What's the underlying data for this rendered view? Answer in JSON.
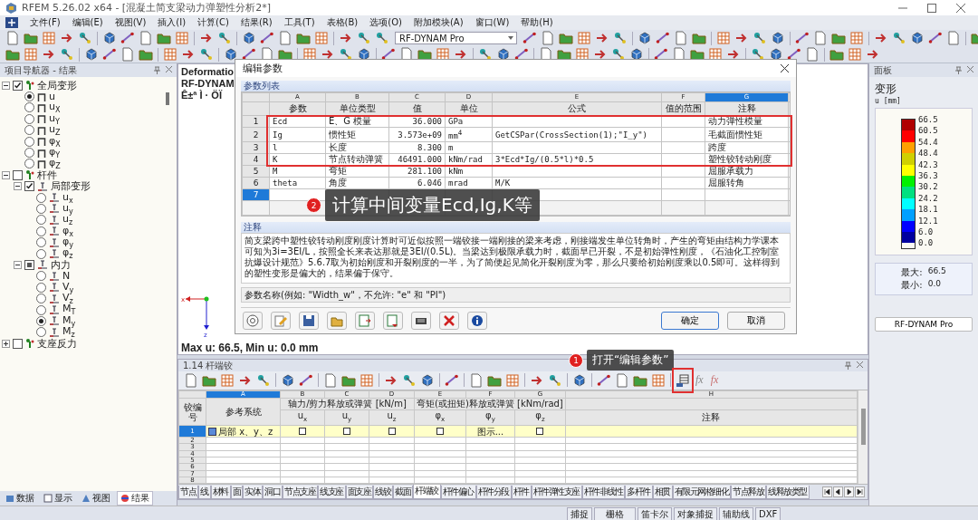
{
  "window": {
    "title": "RFEM 5.26.02 x64 - [混凝土简支梁动力弹塑性分析2*]"
  },
  "menu": [
    "文件(F)",
    "编辑(E)",
    "视图(V)",
    "插入(I)",
    "计算(C)",
    "结果(R)",
    "工具(T)",
    "表格(B)",
    "选项(O)",
    "附加模块(A)",
    "窗口(W)",
    "帮助(H)"
  ],
  "toolbar": {
    "combo": "RF-DYNAM Pro"
  },
  "navigator": {
    "title": "项目导航器 - 结果",
    "tree": [
      {
        "label": "全局变形",
        "kind": "check",
        "checked": true,
        "partial": false,
        "expanded": true,
        "children": [
          {
            "label": "u",
            "kind": "radio",
            "selected": true
          },
          {
            "label": "u$_{X}$",
            "kind": "radio",
            "selected": false
          },
          {
            "label": "u$_{Y}$",
            "kind": "radio",
            "selected": false
          },
          {
            "label": "u$_{Z}$",
            "kind": "radio",
            "selected": false
          },
          {
            "label": "φ$_{X}$",
            "kind": "radio",
            "selected": false
          },
          {
            "label": "φ$_{Y}$",
            "kind": "radio",
            "selected": false
          },
          {
            "label": "φ$_{Z}$",
            "kind": "radio",
            "selected": false
          }
        ]
      },
      {
        "label": "杆件",
        "kind": "check",
        "checked": false,
        "partial": false,
        "expanded": true,
        "children": [
          {
            "label": "局部变形",
            "kind": "check",
            "checked": true,
            "partial": false,
            "expanded": true,
            "children": [
              {
                "label": "u$_{x}$",
                "kind": "radio",
                "selected": false
              },
              {
                "label": "u$_{y}$",
                "kind": "radio",
                "selected": false
              },
              {
                "label": "u$_{z}$",
                "kind": "radio",
                "selected": false
              },
              {
                "label": "φ$_{x}$",
                "kind": "radio",
                "selected": false
              },
              {
                "label": "φ$_{y}$",
                "kind": "radio",
                "selected": false
              },
              {
                "label": "φ$_{z}$",
                "kind": "radio",
                "selected": false
              }
            ]
          },
          {
            "label": "内力",
            "kind": "check",
            "checked": false,
            "partial": true,
            "expanded": true,
            "children": [
              {
                "label": "N",
                "kind": "radio",
                "selected": false
              },
              {
                "label": "V$_{y}$",
                "kind": "radio",
                "selected": false
              },
              {
                "label": "V$_{z}$",
                "kind": "radio",
                "selected": false
              },
              {
                "label": "M$_{T}$",
                "kind": "radio",
                "selected": false
              },
              {
                "label": "M$_{y}$",
                "kind": "radio",
                "selected": true
              },
              {
                "label": "M$_{z}$",
                "kind": "radio",
                "selected": false
              }
            ]
          }
        ]
      },
      {
        "label": "支座反力",
        "kind": "check",
        "checked": false,
        "partial": false,
        "expanded": false
      }
    ],
    "tabs": [
      {
        "label": "数据",
        "selected": false
      },
      {
        "label": "显示",
        "selected": false
      },
      {
        "label": "视图",
        "selected": false
      },
      {
        "label": "结果",
        "selected": true
      }
    ]
  },
  "viewport": {
    "lines": [
      "Deformatio",
      "RF-DYNAM",
      "Ê±ª Ì · ÖÏ"
    ],
    "axes": [
      "x",
      "z"
    ],
    "footer": "Max u: 66.5, Min u: 0.0 mm"
  },
  "dialog": {
    "title": "编辑参数",
    "section": "参数列表",
    "table": {
      "columns": [
        {
          "letter": "A",
          "title": "参数",
          "selected": false
        },
        {
          "letter": "B",
          "title": "单位类型",
          "selected": false
        },
        {
          "letter": "C",
          "title": "值",
          "selected": false
        },
        {
          "letter": "D",
          "title": "单位",
          "selected": false
        },
        {
          "letter": "E",
          "title": "公式",
          "selected": false
        },
        {
          "letter": "F",
          "title": "值的范围",
          "selected": false
        },
        {
          "letter": "G",
          "title": "注释",
          "selected": true
        }
      ],
      "rows": [
        {
          "number": "1",
          "selected": false,
          "cells": [
            "Ecd",
            "E、G 模量",
            "36.000",
            "GPa",
            null,
            null,
            "动力弹性模量"
          ]
        },
        {
          "number": "2",
          "selected": false,
          "cells": [
            "Ig",
            "惯性矩",
            "3.573e+09",
            "mm$^{4}$",
            "GetCSPar(CrossSection(1);\"I_y\")",
            null,
            "毛截面惯性矩"
          ]
        },
        {
          "number": "3",
          "selected": false,
          "cells": [
            "l",
            "长度",
            "8.300",
            "m",
            null,
            null,
            "跨度"
          ]
        },
        {
          "number": "4",
          "selected": false,
          "cells": [
            "K",
            "节点转动弹簧",
            "46491.000",
            "kNm/rad",
            "3*Ecd*Ig/(0.5*l)*0.5",
            null,
            "塑性铰转动刚度"
          ]
        },
        {
          "number": "5",
          "selected": false,
          "cells": [
            "M",
            "弯矩",
            "281.100",
            "kNm",
            null,
            null,
            "屈服承载力"
          ]
        },
        {
          "number": "6",
          "selected": false,
          "cells": [
            "theta",
            "角度",
            "6.046",
            "mrad",
            "M/K",
            null,
            "屈服转角"
          ]
        },
        {
          "number": "7",
          "selected": true
        }
      ]
    },
    "note_title": "注释",
    "note": "简支梁跨中塑性铰转动刚度刚度计算时可近似按照一端铰接一端刚接的梁来考虑，刚接端发生单位转角时，产生的弯矩由结构力学课本可知为3i=3EI/L，按照全长来表达那就是3EI/(0.5L)。当梁达到极限承载力时，截面早已开裂，不是初始弹性刚度，《石油化工控制室抗爆设计规范》5.6.7取为初始刚度和开裂刚度的一半，为了简便起见简化开裂刚度为零，那么只要给初始刚度乘以0.5即可。这样得到的塑性变形是偏大的，结果偏于保守。",
    "hint": "参数名称(例如: \"Width_w\"，不允许: \"e\" 和 \"PI\")",
    "buttons": [
      "确定",
      "取消"
    ]
  },
  "table_panel": {
    "title": "1.14 杆端铰",
    "formula_buttons": [
      "fx",
      "fx"
    ],
    "row_header": "铰编号",
    "columns": [
      {
        "letter": "A",
        "title": "参考系统",
        "selected": true
      },
      {
        "letter": "B",
        "sub": "u$_{x}$",
        "selected": false
      },
      {
        "letter": "C",
        "sub": "u$_{y}$",
        "selected": false
      },
      {
        "letter": "D",
        "sub": "u$_{z}$",
        "selected": false
      },
      {
        "letter": "E",
        "sub": "φ$_{x}$",
        "selected": false
      },
      {
        "letter": "F",
        "sub": "φ$_{y}$",
        "selected": false
      },
      {
        "letter": "G",
        "sub": "φ$_{z}$",
        "selected": false
      },
      {
        "letter": "H",
        "title": "注释",
        "selected": false
      }
    ],
    "groups": [
      "轴力/剪力释放或弹簧 [kN/m]",
      "弯矩(或扭矩)释放或弹簧 [kNm/rad]"
    ],
    "rows": [
      {
        "number": "1",
        "selected": true,
        "system": "局部 x、y、z",
        "cells": [
          {
            "kind": "check",
            "checked": false
          },
          {
            "kind": "check",
            "checked": false
          },
          {
            "kind": "check",
            "checked": false
          },
          {
            "kind": "check",
            "checked": false
          },
          {
            "kind": "text",
            "text": "图示..."
          },
          {
            "kind": "check",
            "checked": false
          }
        ]
      },
      {
        "number": "2",
        "selected": false
      },
      {
        "number": "3",
        "selected": false
      },
      {
        "number": "4",
        "selected": false
      },
      {
        "number": "5",
        "selected": false
      },
      {
        "number": "6",
        "selected": false
      },
      {
        "number": "7",
        "selected": false
      },
      {
        "number": "8",
        "selected": false
      }
    ],
    "tabs": [
      {
        "label": "节点",
        "selected": false
      },
      {
        "label": "线",
        "selected": false
      },
      {
        "label": "材料",
        "selected": false
      },
      {
        "label": "面",
        "selected": false
      },
      {
        "label": "实体",
        "selected": false
      },
      {
        "label": "洞口",
        "selected": false
      },
      {
        "label": "节点支座",
        "selected": false
      },
      {
        "label": "线支座",
        "selected": false
      },
      {
        "label": "面支座",
        "selected": false
      },
      {
        "label": "线铰",
        "selected": false
      },
      {
        "label": "截面",
        "selected": false
      },
      {
        "label": "杆端铰",
        "selected": true
      },
      {
        "label": "杆件偏心",
        "selected": false
      },
      {
        "label": "杆件分段",
        "selected": false
      },
      {
        "label": "杆件",
        "selected": false
      },
      {
        "label": "杆件弹性支座",
        "selected": false
      },
      {
        "label": "杆件非线性",
        "selected": false
      },
      {
        "label": "多杆件",
        "selected": false
      },
      {
        "label": "相贯",
        "selected": false
      },
      {
        "label": "有限元网格细化",
        "selected": false
      },
      {
        "label": "节点释放",
        "selected": false
      },
      {
        "label": "线释放类型",
        "selected": false
      }
    ]
  },
  "panel": {
    "title": "面板",
    "heading": "变形",
    "unit": "u [mm]",
    "legend_values": [
      "66.5",
      "60.5",
      "54.4",
      "48.4",
      "42.3",
      "36.3",
      "30.2",
      "24.2",
      "18.1",
      "12.1",
      "6.0",
      "0.0"
    ],
    "legend_bands": [
      {
        "color": "#b00000"
      },
      {
        "color": "#ff0000"
      },
      {
        "color": "#ffa000"
      },
      {
        "color": "#d0d000"
      },
      {
        "color": "#ffff00"
      },
      {
        "color": "#00f000"
      },
      {
        "color": "#00e080"
      },
      {
        "color": "#00ffff"
      },
      {
        "color": "#00a0ff"
      },
      {
        "color": "#0000ff"
      },
      {
        "color": "#0000a0"
      }
    ],
    "max_label": "最大:",
    "max": "66.5",
    "min_label": "最小:",
    "min": "0.0",
    "button": "RF-DYNAM Pro"
  },
  "status_bar": [
    "捕捉",
    "栅格",
    "笛卡尔",
    "对象捕捉",
    "辅助线",
    "DXF"
  ],
  "annotations": [
    {
      "number": "2",
      "text": "计算中间变量Ecd,Ig,K等"
    },
    {
      "number": "1",
      "text": "打开“编辑参数”"
    }
  ]
}
